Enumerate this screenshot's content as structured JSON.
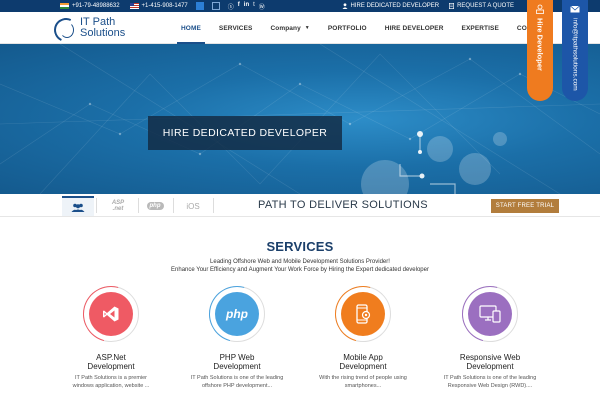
{
  "topbar": {
    "phone_india": "+91-79-48988632",
    "phone_us": "+1-415-908-1477",
    "social_icons": [
      "skype-icon",
      "facebook-icon",
      "linkedin-icon",
      "twitter-icon",
      "wordpress-icon"
    ],
    "hire_label": "HIRE DEDICATED DEVELOPER",
    "quote_label": "REQUEST A QUOTE"
  },
  "logo": {
    "line1": "IT Path",
    "line2": "Solutions"
  },
  "nav": {
    "items": [
      {
        "label": "HOME",
        "active": true
      },
      {
        "label": "SERVICES"
      },
      {
        "label": "Company"
      },
      {
        "label": "PORTFOLIO"
      },
      {
        "label": "HIRE DEVELOPER"
      },
      {
        "label": "EXPERTISE"
      },
      {
        "label": "CONTACT"
      }
    ]
  },
  "side_tabs": {
    "hire_label": "Hire Developer",
    "email_label": "info@itpathsolutions.com"
  },
  "hero": {
    "cta_label": "HIRE DEDICATED DEVELOPER"
  },
  "techbar": {
    "asp_line1": "ASP",
    "asp_line2": ".net",
    "php_label": "php",
    "ios_label": "iOS",
    "tagline": "PATH TO DELIVER SOLUTIONS",
    "trial_label": "START FREE TRIAL"
  },
  "services": {
    "title": "SERVICES",
    "subtitle_line1": "Leading Offshore Web and Mobile Development Solutions Provider!",
    "subtitle_line2": "Enhance Your Efficiency and Augment Your Work Force by Hiring the Expert dedicated developer",
    "cards": [
      {
        "title_line1": "ASP.Net",
        "title_line2": "Development",
        "desc_line1": "IT Path Solutions is a premier",
        "desc_line2": "windows application, website ...",
        "icon": "visual-studio-icon",
        "color": "#ef5a64"
      },
      {
        "title_line1": "PHP Web",
        "title_line2": "Development",
        "desc_line1": "IT Path Solutions is one of the leading",
        "desc_line2": "offshore PHP development...",
        "icon_text": "php",
        "color": "#4aa3df"
      },
      {
        "title_line1": "Mobile App",
        "title_line2": "Development",
        "desc_line1": "With the rising trend of people using",
        "desc_line2": "smartphones...",
        "icon": "mobile-gear-icon",
        "color": "#f07d1e"
      },
      {
        "title_line1": "Responsive Web",
        "title_line2": "Development",
        "desc_line1": "IT Path Solutions is one of the leading",
        "desc_line2": "Responsive Web Design (RWD)....",
        "icon": "devices-icon",
        "color": "#9b6fc0"
      }
    ]
  }
}
